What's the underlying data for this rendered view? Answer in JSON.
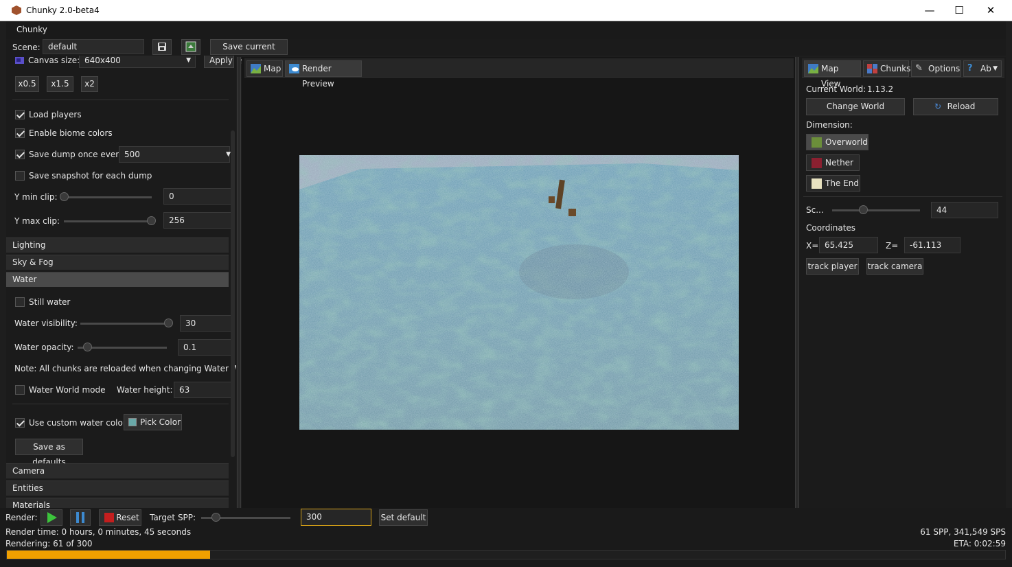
{
  "window": {
    "title": "Chunky 2.0-beta4",
    "minimize_glyph": "—",
    "maximize_glyph": "☐",
    "close_glyph": "✕"
  },
  "menu": {
    "chunky": "Chunky"
  },
  "scene_bar": {
    "scene_label": "Scene:",
    "scene_name": "default",
    "save_frame_label": "Save current frame"
  },
  "left_panel": {
    "canvas_size_label": "Canvas size:",
    "canvas_size_value": "640x400",
    "apply_label": "Apply",
    "scale_buttons": [
      "x0.5",
      "x1.5",
      "x2"
    ],
    "load_players": {
      "label": "Load players",
      "checked": true
    },
    "enable_biome_colors": {
      "label": "Enable biome colors",
      "checked": true
    },
    "save_dump": {
      "label": "Save dump once every",
      "checked": true,
      "value": "500"
    },
    "save_snapshot": {
      "label": "Save snapshot for each dump",
      "checked": false
    },
    "y_min_clip": {
      "label": "Y min clip:",
      "value": "0",
      "fraction": 0.0
    },
    "y_max_clip": {
      "label": "Y max clip:",
      "value": "256",
      "fraction": 1.0
    },
    "sections": {
      "lighting": "Lighting",
      "sky_fog": "Sky & Fog",
      "water": "Water",
      "camera": "Camera",
      "entities": "Entities",
      "materials": "Materials"
    },
    "water": {
      "still_water": {
        "label": "Still water",
        "checked": false
      },
      "visibility": {
        "label": "Water visibility:",
        "value": "30",
        "fraction": 1.0
      },
      "opacity": {
        "label": "Water opacity:",
        "value": "0.1",
        "fraction": 0.1
      },
      "note": "Note: All chunks are reloaded when changing Water World",
      "water_world_mode": {
        "label": "Water World mode",
        "checked": false
      },
      "water_height_label": "Water height:",
      "water_height_value": "63",
      "custom_color": {
        "label": "Use custom water color:",
        "checked": true
      },
      "pick_color_label": "Pick Color",
      "swatch_color": "#6aa9a9",
      "save_defaults_label": "Save as defaults"
    }
  },
  "center_panel": {
    "tabs": [
      "Map",
      "Render Preview"
    ]
  },
  "right_panel": {
    "tabs": [
      "Map View",
      "Chunks",
      "Options",
      "Ab"
    ],
    "current_world_label": "Current World:",
    "current_world_value": "1.13.2",
    "change_world_label": "Change World",
    "reload_label": "Reload",
    "dimension_label": "Dimension:",
    "dimensions": [
      {
        "label": "Overworld",
        "color": "#6b8e3a",
        "active": true
      },
      {
        "label": "Nether",
        "color": "#8b2030",
        "active": false
      },
      {
        "label": "The End",
        "color": "#e8e2c0",
        "active": false
      }
    ],
    "scale_label": "Sc...",
    "scale_value": "44",
    "scale_fraction": 0.3,
    "coordinates_label": "Coordinates",
    "x_label": "X=",
    "x_value": "65.425",
    "z_label": "Z=",
    "z_value": "-61.113",
    "track_player_label": "track player",
    "track_camera_label": "track camera"
  },
  "bottom": {
    "render_label": "Render:",
    "reset_label": "Reset",
    "target_spp_label": "Target SPP:",
    "target_spp_value": "300",
    "target_spp_fraction": 0.15,
    "set_default_label": "Set default",
    "render_time": "Render time: 0 hours, 0 minutes, 45 seconds",
    "rendering_status": "Rendering: 61 of 300",
    "spp_stats": "61 SPP, 341,549 SPS",
    "eta": "ETA: 0:02:59",
    "progress": 0.2033,
    "accent_color": "#f0a000"
  }
}
